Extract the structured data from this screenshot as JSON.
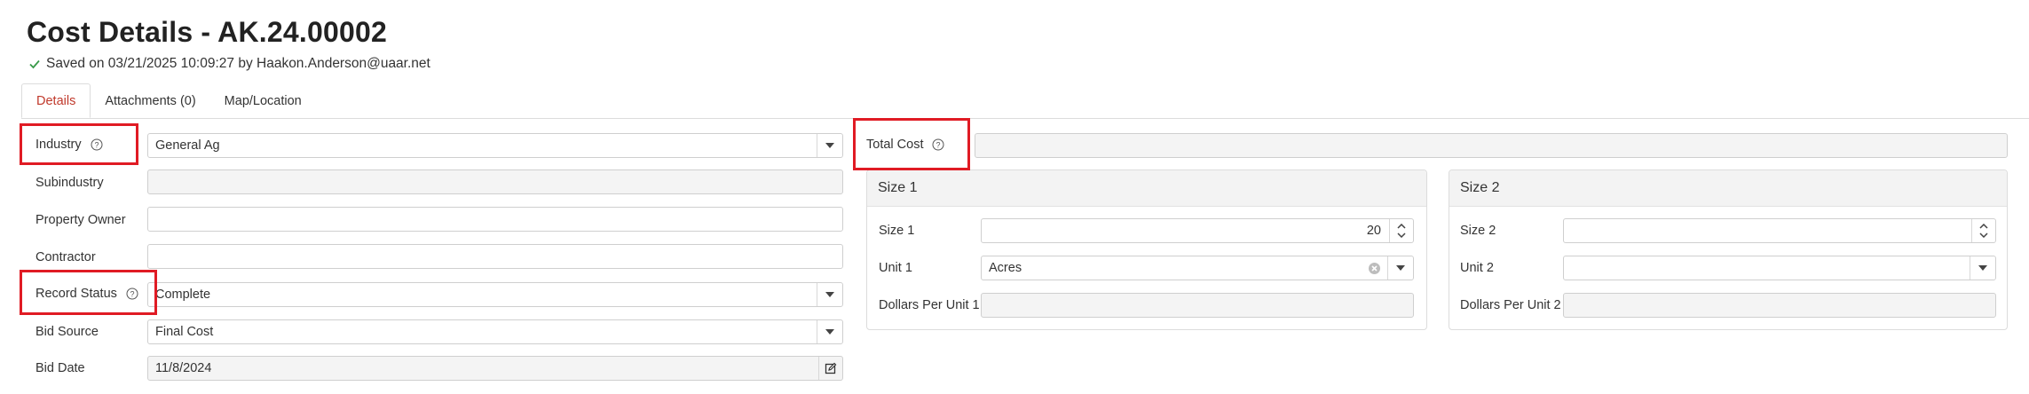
{
  "page": {
    "title": "Cost Details - AK.24.00002",
    "saved_status": "Saved on 03/21/2025 10:09:27 by Haakon.Anderson@uaar.net"
  },
  "tabs": [
    {
      "label": "Details",
      "active": true
    },
    {
      "label": "Attachments (0)",
      "active": false
    },
    {
      "label": "Map/Location",
      "active": false
    }
  ],
  "form": {
    "industry": {
      "label": "Industry",
      "value": "General Ag"
    },
    "subindustry": {
      "label": "Subindustry",
      "value": ""
    },
    "property_owner": {
      "label": "Property Owner",
      "value": ""
    },
    "contractor": {
      "label": "Contractor",
      "value": ""
    },
    "record_status": {
      "label": "Record Status",
      "value": "Complete"
    },
    "bid_source": {
      "label": "Bid Source",
      "value": "Final Cost"
    },
    "bid_date": {
      "label": "Bid Date",
      "value": "11/8/2024"
    },
    "total_cost": {
      "label": "Total Cost",
      "value": ""
    }
  },
  "size1_panel": {
    "title": "Size 1",
    "size": {
      "label": "Size 1",
      "value": "20"
    },
    "unit": {
      "label": "Unit 1",
      "value": "Acres"
    },
    "dollars_per_unit": {
      "label": "Dollars Per Unit 1",
      "value": ""
    }
  },
  "size2_panel": {
    "title": "Size 2",
    "size": {
      "label": "Size 2",
      "value": ""
    },
    "unit": {
      "label": "Unit 2",
      "value": ""
    },
    "dollars_per_unit": {
      "label": "Dollars Per Unit 2",
      "value": ""
    }
  },
  "colors": {
    "highlight": "#e01b24",
    "active_tab": "#c0392b",
    "check": "#3a9a4a"
  }
}
